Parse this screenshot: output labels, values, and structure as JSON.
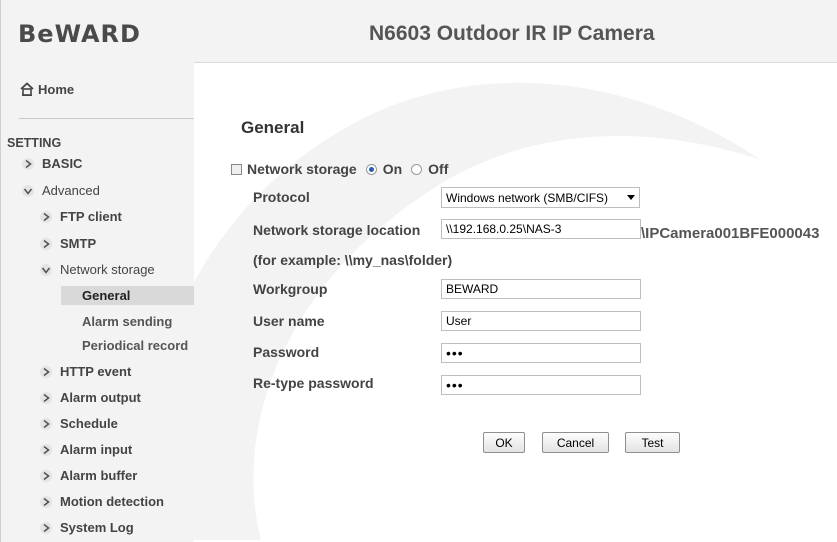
{
  "header": {
    "logo": "BeWARD",
    "title": "N6603 Outdoor IR IP Camera"
  },
  "sidebar": {
    "home_label": "Home",
    "setting_label": "SETTING",
    "items": [
      {
        "label": "BASIC",
        "icon": "arrow-right-icon"
      },
      {
        "label": "Advanced",
        "icon": "arrow-down-icon"
      },
      {
        "label": "FTP client",
        "icon": "arrow-right-icon"
      },
      {
        "label": "SMTP",
        "icon": "arrow-right-icon"
      },
      {
        "label": "Network storage",
        "icon": "arrow-down-icon"
      },
      {
        "label": "General"
      },
      {
        "label": "Alarm sending"
      },
      {
        "label": "Periodical record"
      },
      {
        "label": "HTTP event",
        "icon": "arrow-right-icon"
      },
      {
        "label": "Alarm output",
        "icon": "arrow-right-icon"
      },
      {
        "label": "Schedule",
        "icon": "arrow-right-icon"
      },
      {
        "label": "Alarm input",
        "icon": "arrow-right-icon"
      },
      {
        "label": "Alarm buffer",
        "icon": "arrow-right-icon"
      },
      {
        "label": "Motion detection",
        "icon": "arrow-right-icon"
      },
      {
        "label": "System Log",
        "icon": "arrow-right-icon"
      }
    ]
  },
  "main": {
    "section_title": "General",
    "network_storage": {
      "label": "Network storage",
      "on_label": "On",
      "off_label": "Off",
      "selected": "On"
    },
    "fields": {
      "protocol_label": "Protocol",
      "protocol_value": "Windows network (SMB/CIFS)",
      "location_label": "Network storage location",
      "location_value": "\\\\192.168.0.25\\NAS-3",
      "location_suffix": "\\IPCamera001BFE000043",
      "example_label": "(for example: \\\\my_nas\\folder)",
      "workgroup_label": "Workgroup",
      "workgroup_value": "BEWARD",
      "username_label": "User name",
      "username_value": "User",
      "password_label": "Password",
      "password_value": "•••",
      "retype_label": "Re-type password",
      "retype_value": "•••"
    },
    "buttons": {
      "ok": "OK",
      "cancel": "Cancel",
      "test": "Test"
    }
  },
  "colors": {
    "panel_bg": "#f3f3f3",
    "active_item_bg": "#d9d9d9",
    "radio_selected": "#2a5da8"
  }
}
